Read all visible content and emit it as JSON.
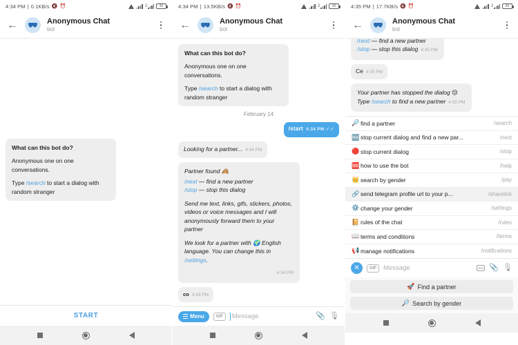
{
  "panels": [
    {
      "status": {
        "time": "4:34 PM",
        "speed": "0.1KB/s",
        "battery": "30"
      },
      "header": {
        "title": "Anonymous Chat",
        "subtitle": "bot",
        "back_icon": "back-arrow-icon",
        "menu_icon": "kebab-menu-icon",
        "avatar_icon": "mask-avatar-icon"
      },
      "messages": [
        {
          "id": "what-can-bot-do",
          "title": "What can this bot do?",
          "line1": "Anonymous one on one conversations.",
          "line2_pre": "Type ",
          "line2_cmd": "/search",
          "line2_post": " to start a dialog with random stranger"
        }
      ],
      "start_label": "START"
    },
    {
      "status": {
        "time": "4:34 PM",
        "speed": "13.5KB/s",
        "battery": "30"
      },
      "header": {
        "title": "Anonymous Chat",
        "subtitle": "bot"
      },
      "date_separator": "February 14",
      "messages": {
        "intro": {
          "title": "What can this bot do?",
          "line1": "Anonymous one on one conversations.",
          "line2_pre": "Type ",
          "line2_cmd": "/search",
          "line2_post": " to start a dialog with random stranger"
        },
        "start": {
          "text": "/start",
          "time": "4:34 PM",
          "check": "✓✓"
        },
        "looking": {
          "text": "Looking for a partner...",
          "time": "4:34 PM"
        },
        "partner_found": {
          "line1": "Partner found 🙈",
          "cmd_next": "/next",
          "next_desc": " — find a new partner",
          "cmd_stop": "/stop",
          "stop_desc": " — stop this dialog",
          "para2": "Send me text, links, gifs, stickers, photos, videos or voice messages and I will anonymously forward them to your partner",
          "para3_pre": "We look for a partner with 🌍 English language. You can change this in ",
          "para3_cmd": "/settings",
          "para3_post": ".",
          "time": "4:34 PM"
        },
        "co": {
          "text": "co",
          "time": "4:34 PM"
        }
      },
      "input": {
        "menu_label": "Menu",
        "gif_label": "GIF",
        "placeholder": "Message",
        "attach_icon": "paperclip-icon",
        "mic_icon": "microphone-icon"
      }
    },
    {
      "status": {
        "time": "4:35 PM",
        "speed": "17.7KB/s",
        "battery": "30"
      },
      "header": {
        "title": "Anonymous Chat",
        "subtitle": "bot"
      },
      "messages": {
        "partner_cmds": {
          "cmd_next": "/next",
          "next_desc": " — find a new partner",
          "cmd_stop": "/stop",
          "stop_desc": " — stop this dialog",
          "time": "4:35 PM"
        },
        "ce": {
          "text": "Ce",
          "time": "4:35 PM"
        },
        "stopped": {
          "line1": "Your partner has stopped the dialog 😒",
          "line2_pre": "Type ",
          "line2_cmd": "/search",
          "line2_post": " to find a new partner",
          "time": "4:35 PM"
        }
      },
      "command_menu": [
        {
          "emoji": "🔎",
          "icon": "magnifier-icon",
          "label": "find a partner",
          "command": "/search",
          "highlight": false
        },
        {
          "emoji": "🆕",
          "icon": "new-badge-icon",
          "label": "stop current dialog and find a new par...",
          "command": "/next",
          "highlight": false
        },
        {
          "emoji": "🔴",
          "icon": "red-circle-icon",
          "label": "stop current dialog",
          "command": "/stop",
          "highlight": false
        },
        {
          "emoji": "🆘",
          "icon": "sos-badge-icon",
          "label": "how to use the bot",
          "command": "/help",
          "highlight": false
        },
        {
          "emoji": "👑",
          "icon": "crown-icon",
          "label": "search by gender",
          "command": "/pay",
          "highlight": false
        },
        {
          "emoji": "🔗",
          "icon": "link-icon",
          "label": "send telegram profile url to your p...",
          "command": "/sharelink",
          "highlight": true
        },
        {
          "emoji": "⚙️",
          "icon": "gear-icon",
          "label": "change your gender",
          "command": "/settings",
          "highlight": false
        },
        {
          "emoji": "📔",
          "icon": "notebook-icon",
          "label": "rules of the chat",
          "command": "/rules",
          "highlight": false
        },
        {
          "emoji": "📖",
          "icon": "open-book-icon",
          "label": "terms and conditions",
          "command": "/terms",
          "highlight": false
        },
        {
          "emoji": "📢",
          "icon": "loudspeaker-icon",
          "label": "manage notifications",
          "command": "/notifications",
          "highlight": false
        }
      ],
      "input": {
        "gif_label": "GIF",
        "placeholder": "Message",
        "keyboard_icon": "keyboard-icon",
        "attach_icon": "paperclip-icon",
        "mic_icon": "microphone-icon"
      },
      "keyboard_buttons": [
        {
          "emoji": "🚀",
          "label": "Find a partner"
        },
        {
          "emoji": "🔎",
          "label": "Search by gender"
        }
      ]
    }
  ],
  "colors": {
    "accent": "#4aa8e8",
    "bubble_in": "#eeeeee",
    "bubble_out": "#4aa8e8",
    "link": "#4a9fe0"
  },
  "navbar": {
    "recents_icon": "square-icon",
    "home_icon": "circle-icon",
    "back_icon": "triangle-back-icon"
  }
}
